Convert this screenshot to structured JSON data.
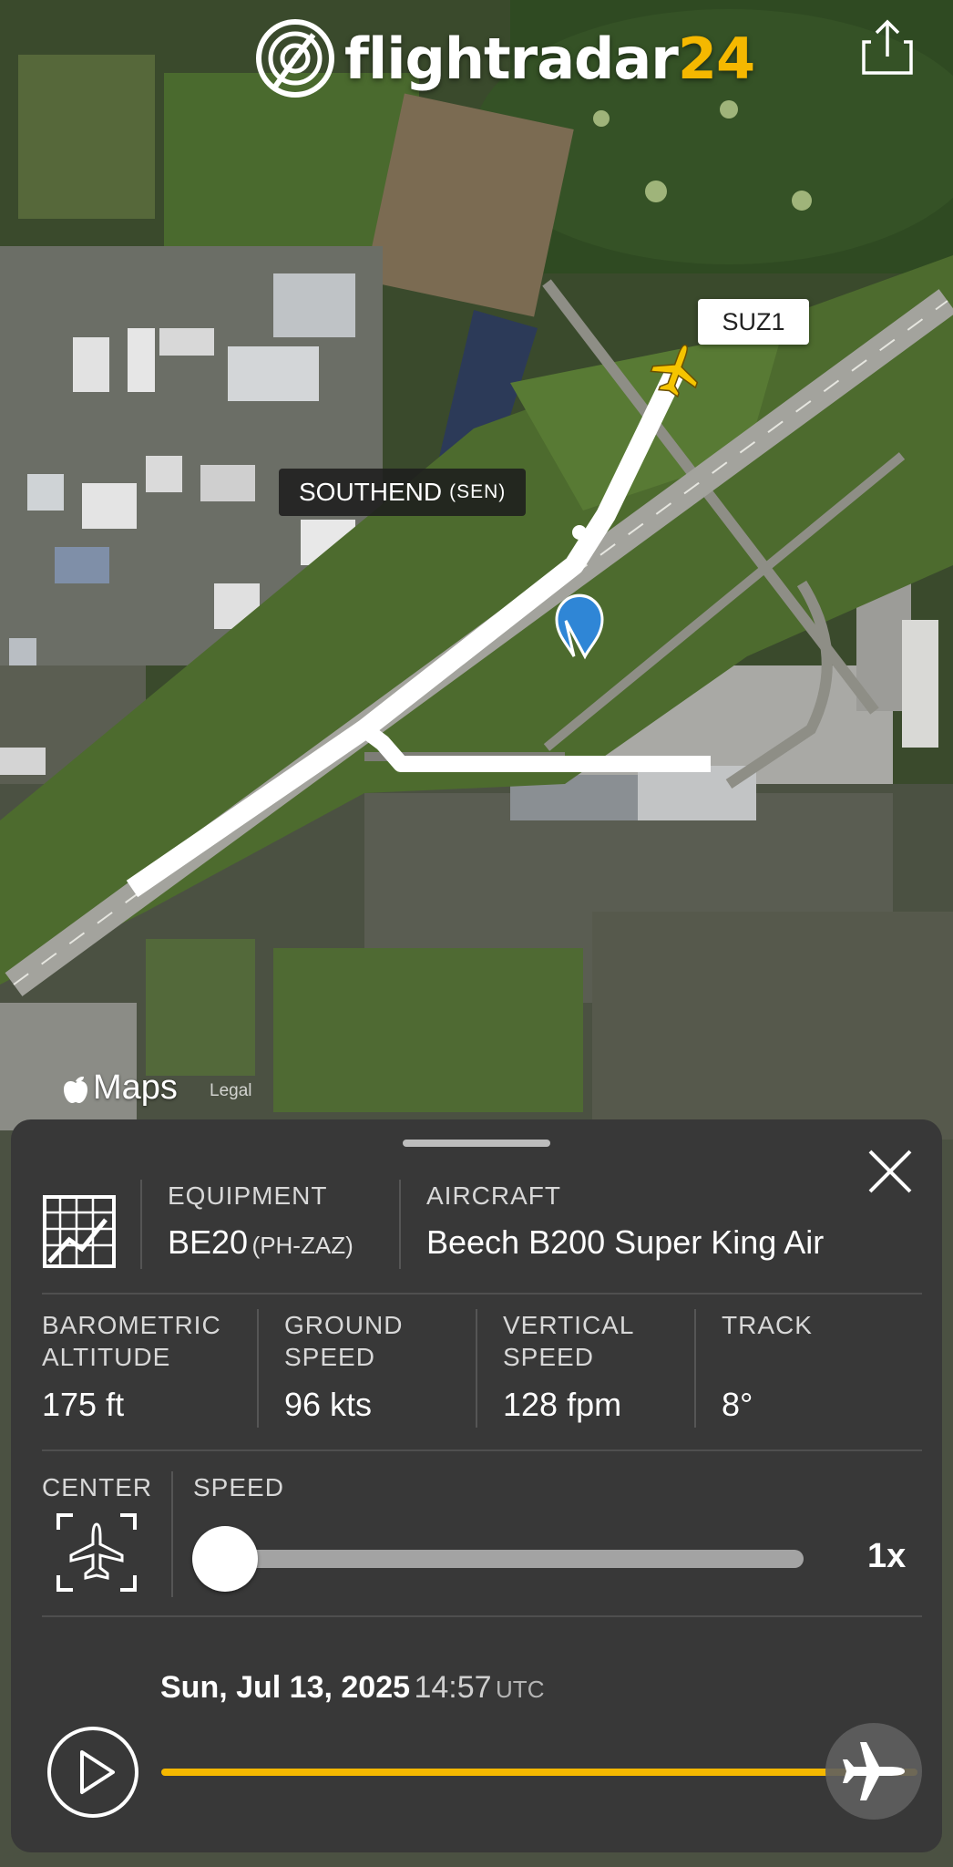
{
  "app": {
    "logo_text": "flightradar",
    "logo_number": "24"
  },
  "map": {
    "callsign": "SUZ1",
    "airport_name": "SOUTHEND",
    "airport_code": "(SEN)",
    "brand": "Maps",
    "legal": "Legal"
  },
  "panel": {
    "equipment": {
      "label": "EQUIPMENT",
      "type": "BE20",
      "registration": "(PH-ZAZ)"
    },
    "aircraft": {
      "label": "AIRCRAFT",
      "value": "Beech B200 Super King Air"
    },
    "stats": [
      {
        "label_line1": "BAROMETRIC",
        "label_line2": "ALTITUDE",
        "value": "175 ft"
      },
      {
        "label_line1": "GROUND",
        "label_line2": "SPEED",
        "value": "96 kts"
      },
      {
        "label_line1": "VERTICAL",
        "label_line2": "SPEED",
        "value": "128 fpm"
      },
      {
        "label_line1": "TRACK",
        "label_line2": "",
        "value": "8°"
      }
    ],
    "center_label": "CENTER",
    "speed_label": "SPEED",
    "speed_value": "1x",
    "speed_slider_fraction": 0,
    "date": "Sun, Jul 13, 2025",
    "time": "14:57",
    "timezone": "UTC",
    "timeline_progress": 1.0
  },
  "icons": {
    "share": "share-icon",
    "close": "close-icon",
    "equipment": "blueprint-icon",
    "center": "center-on-plane-icon",
    "play": "play-icon",
    "plane": "airplane-icon",
    "pin": "location-pin-icon",
    "apple": "apple-logo-icon"
  },
  "colors": {
    "accent": "#f5b800",
    "panel_bg": "#383838",
    "pin": "#2f86d6",
    "track": "#ffffff"
  }
}
